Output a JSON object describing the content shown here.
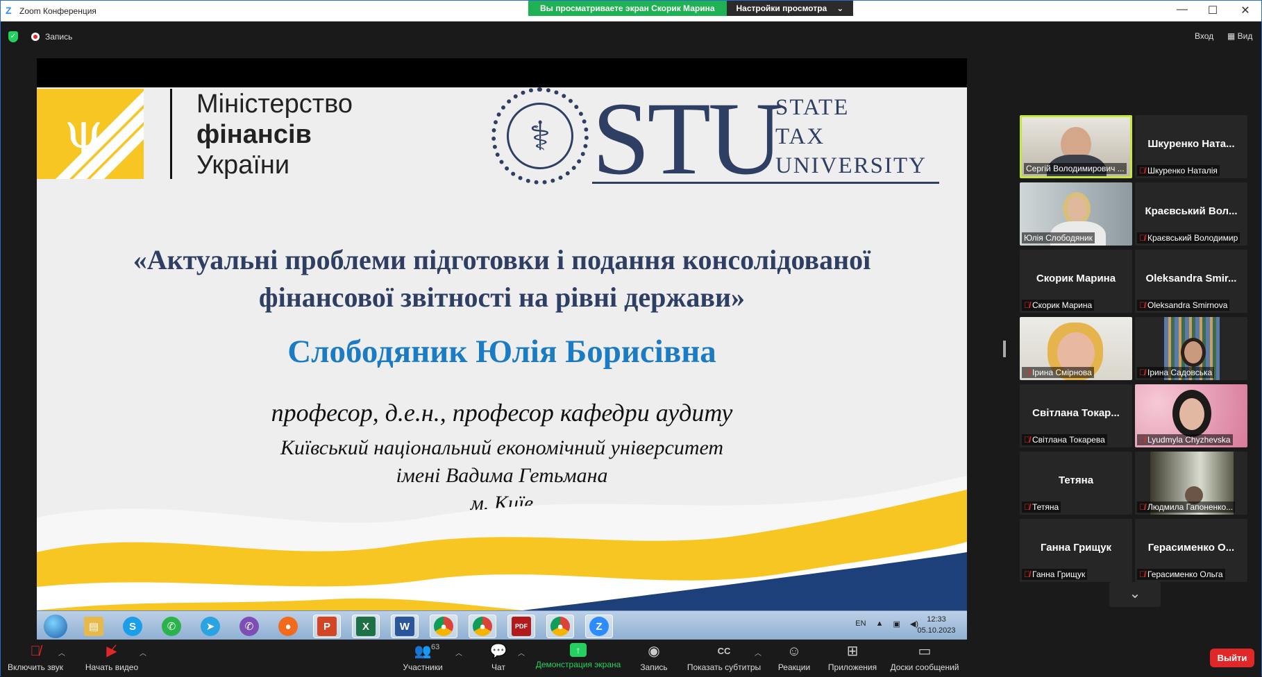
{
  "titlebar": {
    "app_title": "Zoom Конференция",
    "share_banner": "Вы просматриваете экран Скорик Марина",
    "view_settings": "Настройки просмотра",
    "minimize": "—",
    "maximize": "☐",
    "close": "✕"
  },
  "topbar": {
    "recording": "Запись",
    "exit": "Вход",
    "view": "Вид"
  },
  "slide": {
    "ministry_line1": "Міністерство",
    "ministry_line2": "фінансів",
    "ministry_line3": "України",
    "stu_letters": "STU",
    "stu_word1": "STATE",
    "stu_word2": "TAX",
    "stu_word3": "UNIVERSITY",
    "title_line1": "«Актуальні проблеми підготовки і подання консолідованої",
    "title_line2": "фінансової звітності на рівні держави»",
    "speaker": "Слободяник Юлія Борисівна",
    "position": "професор, д.е.н., професор кафедри аудиту",
    "university_line1": "Київський національний економічний університет",
    "university_line2": "імені Вадима Гетьмана",
    "university_line3": "м. Київ"
  },
  "taskbar": {
    "apps": [
      "explorer",
      "skype",
      "whatsapp",
      "telegram",
      "viber",
      "firefox",
      "powerpoint",
      "excel",
      "word",
      "chrome",
      "chrome-profile",
      "pdf",
      "chrome-active",
      "zoom"
    ],
    "lang": "EN",
    "time": "12:33",
    "date": "05.10.2023"
  },
  "participants": [
    {
      "name": "Сергій Володимирович ...",
      "big": "",
      "video": true,
      "active": true
    },
    {
      "name": "Шкуренко Наталія",
      "big": "Шкуренко  Ната...",
      "video": false
    },
    {
      "name": "Юлія Слободяник",
      "big": "",
      "video": true
    },
    {
      "name": "Краєвський Володимир",
      "big": "Краєвський  Вол...",
      "video": false
    },
    {
      "name": "Скорик Марина",
      "big": "Скорик Марина",
      "video": false
    },
    {
      "name": "Oleksandra Smirnova",
      "big": "Oleksandra  Smir...",
      "video": false
    },
    {
      "name": "Ірина Смірнова",
      "big": "",
      "video": true
    },
    {
      "name": "Ірина Садовська",
      "big": "",
      "video": true
    },
    {
      "name": "Світлана Токарева",
      "big": "Світлана  Токар...",
      "video": false
    },
    {
      "name": "Lyudmyla Chyzhevska",
      "big": "",
      "video": true
    },
    {
      "name": "Тетяна",
      "big": "Тетяна",
      "video": false
    },
    {
      "name": "Людмила Гапоненко...",
      "big": "",
      "video": true
    },
    {
      "name": "Ганна Грищук",
      "big": "Ганна Грищук",
      "video": false
    },
    {
      "name": "Герасименко Ольга",
      "big": "Герасименко  О...",
      "video": false
    }
  ],
  "toolbar": {
    "unmute": "Включить звук",
    "start_video": "Начать видео",
    "participants": "Участники",
    "participants_count": "63",
    "chat": "Чат",
    "share_screen": "Демонстрация экрана",
    "record": "Запись",
    "captions": "Показать субтитры",
    "reactions": "Реакции",
    "apps": "Приложения",
    "whiteboards": "Доски сообщений",
    "leave": "Выйти"
  },
  "colors": {
    "accent_blue": "#2d8cff",
    "share_green": "#1fb255",
    "leave_red": "#e02828",
    "slide_navy": "#2f3f63",
    "slide_blue": "#1b7cc4",
    "ua_yellow": "#f7c623"
  }
}
